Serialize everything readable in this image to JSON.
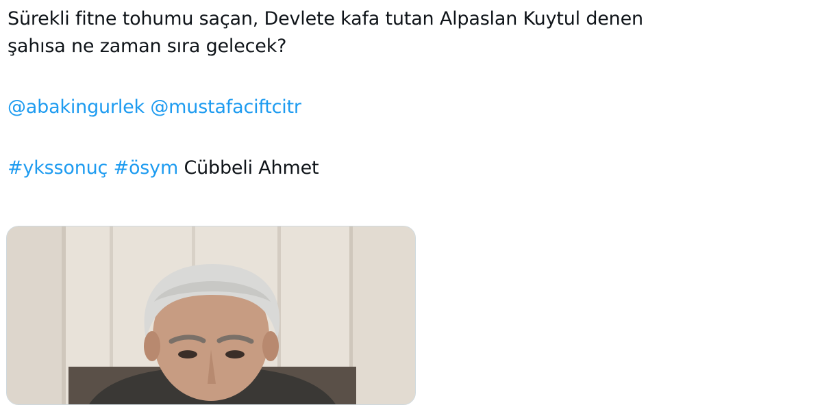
{
  "tweet": {
    "text_line1": "Sürekli fitne tohumu saçan, Devlete kafa tutan Alpaslan Kuytul denen",
    "text_line2": "şahısa ne zaman sıra gelecek?",
    "mentions": [
      "@abakingurlek",
      "@mustafaciftcitr"
    ],
    "hashtags": [
      "#ykssonuç",
      "#ösym"
    ],
    "trailing_text": "Cübbeli Ahmet"
  },
  "colors": {
    "link": "#1d9bf0",
    "text": "#0f1419",
    "border": "#cfd9de"
  },
  "media": {
    "icon": "photo"
  }
}
